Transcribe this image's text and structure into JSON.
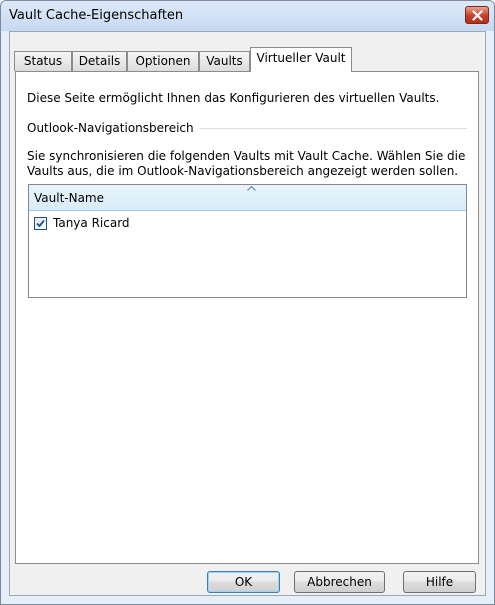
{
  "window": {
    "title": "Vault Cache-Eigenschaften"
  },
  "tabs": [
    {
      "label": "Status"
    },
    {
      "label": "Details"
    },
    {
      "label": "Optionen"
    },
    {
      "label": "Vaults"
    },
    {
      "label": "Virtueller Vault",
      "active": true
    }
  ],
  "panel": {
    "intro": "Diese Seite ermöglicht Ihnen das Konfigurieren des virtuellen Vaults.",
    "group_label": "Outlook-Navigationsbereich",
    "description_line1": "Sie synchronisieren die folgenden Vaults mit Vault Cache. Wählen Sie die",
    "description_line2": "Vaults aus, die im Outlook-Navigationsbereich angezeigt werden sollen.",
    "list": {
      "column_header": "Vault-Name",
      "sort": "ascending",
      "rows": [
        {
          "name": "Tanya Ricard",
          "checked": true
        }
      ]
    }
  },
  "buttons": {
    "ok": "OK",
    "cancel": "Abbrechen",
    "help": "Hilfe"
  },
  "icons": {
    "close": "close-icon",
    "sort": "sort-ascending-icon",
    "check": "checkmark-icon"
  },
  "colors": {
    "close_button": "#c9452b",
    "checkbox_check": "#1f4f8a",
    "list_header": "#d8ebf9"
  }
}
